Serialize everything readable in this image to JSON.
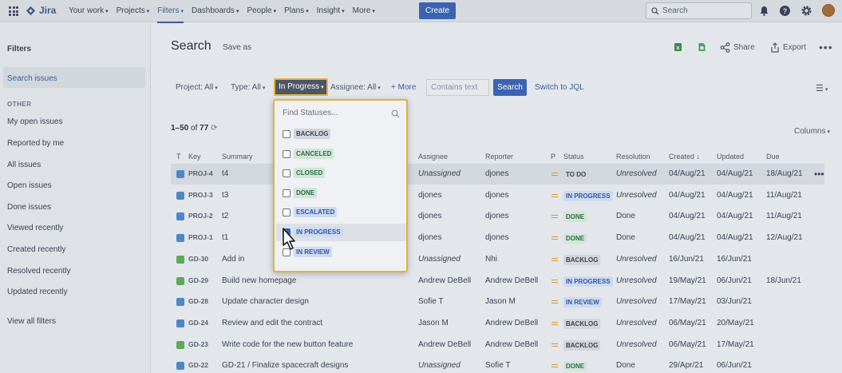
{
  "topnav": {
    "logo": "Jira",
    "items": [
      "Your work",
      "Projects",
      "Filters",
      "Dashboards",
      "People",
      "Plans",
      "Insight",
      "More"
    ],
    "create": "Create",
    "search_placeholder": "Search"
  },
  "sidebar": {
    "title": "Filters",
    "selected": "Search issues",
    "other_header": "OTHER",
    "items": [
      "My open issues",
      "Reported by me",
      "All issues",
      "Open issues",
      "Done issues",
      "Viewed recently",
      "Created recently",
      "Resolved recently",
      "Updated recently"
    ],
    "view_all": "View all filters"
  },
  "header": {
    "title": "Search",
    "save_as": "Save as",
    "share": "Share",
    "export": "Export"
  },
  "filters": {
    "project": "Project: All",
    "type": "Type: All",
    "status": "In Progress",
    "assignee": "Assignee: All",
    "more": "More",
    "contains_placeholder": "Contains text",
    "search_button": "Search",
    "switch_jql": "Switch to JQL"
  },
  "results": {
    "range": "1–50",
    "of": "of",
    "total": "77",
    "columns": "Columns"
  },
  "table": {
    "headers": [
      "T",
      "Key",
      "Summary",
      "Assignee",
      "Reporter",
      "P",
      "Status",
      "Resolution",
      "Created",
      "Updated",
      "Due"
    ],
    "rows": [
      {
        "type": "task",
        "key": "PROJ-4",
        "summary": "t4",
        "assignee": "Unassigned",
        "reporter": "djones",
        "status": "TO DO",
        "status_color": "grey",
        "resolution": "Unresolved",
        "created": "04/Aug/21",
        "updated": "04/Aug/21",
        "due": "18/Aug/21"
      },
      {
        "type": "task",
        "key": "PROJ-3",
        "summary": "t3",
        "assignee": "djones",
        "reporter": "djones",
        "status": "IN PROGRESS",
        "status_color": "blue",
        "resolution": "Unresolved",
        "created": "04/Aug/21",
        "updated": "04/Aug/21",
        "due": "11/Aug/21"
      },
      {
        "type": "task",
        "key": "PROJ-2",
        "summary": "t2",
        "assignee": "djones",
        "reporter": "djones",
        "status": "DONE",
        "status_color": "green",
        "resolution": "Done",
        "created": "04/Aug/21",
        "updated": "04/Aug/21",
        "due": "11/Aug/21"
      },
      {
        "type": "task",
        "key": "PROJ-1",
        "summary": "t1",
        "assignee": "djones",
        "reporter": "djones",
        "status": "DONE",
        "status_color": "green",
        "resolution": "Done",
        "created": "04/Aug/21",
        "updated": "04/Aug/21",
        "due": "12/Aug/21"
      },
      {
        "type": "story",
        "key": "GD-30",
        "summary": "Add in",
        "assignee": "Unassigned",
        "reporter": "Nhi",
        "status": "BACKLOG",
        "status_color": "grey",
        "resolution": "Unresolved",
        "created": "16/Jun/21",
        "updated": "16/Jun/21",
        "due": ""
      },
      {
        "type": "story",
        "key": "GD-29",
        "summary": "Build new homepage",
        "assignee": "Andrew DeBell",
        "reporter": "Andrew DeBell",
        "status": "IN PROGRESS",
        "status_color": "blue",
        "resolution": "Unresolved",
        "created": "19/May/21",
        "updated": "06/Jun/21",
        "due": "18/Jun/21"
      },
      {
        "type": "task",
        "key": "GD-28",
        "summary": "Update character design",
        "assignee": "Sofie T",
        "reporter": "Jason M",
        "status": "IN REVIEW",
        "status_color": "blue",
        "resolution": "Unresolved",
        "created": "17/May/21",
        "updated": "03/Jun/21",
        "due": ""
      },
      {
        "type": "task",
        "key": "GD-24",
        "summary": "Review and edit the contract",
        "assignee": "Jason M",
        "reporter": "Andrew DeBell",
        "status": "BACKLOG",
        "status_color": "grey",
        "resolution": "Unresolved",
        "created": "06/May/21",
        "updated": "20/May/21",
        "due": ""
      },
      {
        "type": "story",
        "key": "GD-23",
        "summary": "Write code for the new button feature",
        "assignee": "Andrew DeBell",
        "reporter": "Andrew DeBell",
        "status": "BACKLOG",
        "status_color": "grey",
        "resolution": "Unresolved",
        "created": "06/May/21",
        "updated": "17/May/21",
        "due": ""
      },
      {
        "type": "task",
        "key": "GD-22",
        "summary": "GD-21 / Finalize spacecraft designs",
        "assignee": "Unassigned",
        "reporter": "Sofie T",
        "status": "DONE",
        "status_color": "green",
        "resolution": "Done",
        "created": "29/Apr/21",
        "updated": "06/Jun/21",
        "due": ""
      }
    ]
  },
  "dropdown": {
    "placeholder": "Find Statuses...",
    "options": [
      {
        "label": "BACKLOG",
        "color": "grey",
        "checked": false
      },
      {
        "label": "CANCELED",
        "color": "green",
        "checked": false
      },
      {
        "label": "CLOSED",
        "color": "green",
        "checked": false
      },
      {
        "label": "DONE",
        "color": "green",
        "checked": false
      },
      {
        "label": "ESCALATED",
        "color": "blue",
        "checked": false
      },
      {
        "label": "IN PROGRESS",
        "color": "blue",
        "checked": true
      },
      {
        "label": "IN REVIEW",
        "color": "blue",
        "checked": false
      }
    ]
  }
}
